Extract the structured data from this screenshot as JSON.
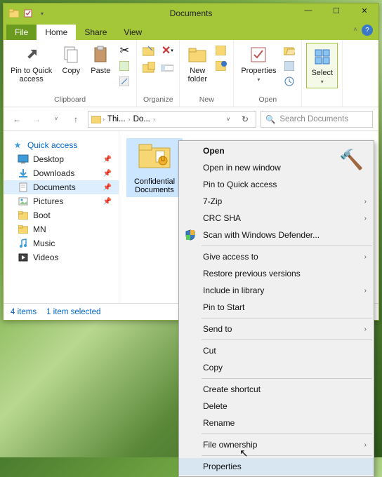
{
  "window": {
    "title": "Documents",
    "buttons": {
      "min": "—",
      "max": "☐",
      "close": "✕"
    }
  },
  "tabs": {
    "file": "File",
    "home": "Home",
    "share": "Share",
    "view": "View"
  },
  "ribbon": {
    "clipboard": {
      "label": "Clipboard",
      "pin": "Pin to Quick\naccess",
      "copy": "Copy",
      "paste": "Paste"
    },
    "organize": {
      "label": "Organize"
    },
    "new": {
      "label": "New",
      "newfolder": "New\nfolder"
    },
    "open": {
      "label": "Open",
      "properties": "Properties"
    },
    "select": {
      "label": "Select",
      "select": "Select"
    }
  },
  "address": {
    "crumb1": "Thi...",
    "crumb2": "Do..."
  },
  "search": {
    "placeholder": "Search Documents"
  },
  "sidebar": {
    "quick": "Quick access",
    "items": [
      {
        "icon": "desktop",
        "label": "Desktop",
        "pin": true
      },
      {
        "icon": "downloads",
        "label": "Downloads",
        "pin": true
      },
      {
        "icon": "documents",
        "label": "Documents",
        "pin": true,
        "selected": true
      },
      {
        "icon": "pictures",
        "label": "Pictures",
        "pin": true
      },
      {
        "icon": "folder",
        "label": "Boot",
        "pin": false
      },
      {
        "icon": "folder",
        "label": "MN",
        "pin": false
      },
      {
        "icon": "music",
        "label": "Music",
        "pin": false
      },
      {
        "icon": "videos",
        "label": "Videos",
        "pin": false
      }
    ]
  },
  "content": {
    "folder_name": "Confidential Documents"
  },
  "status": {
    "items": "4 items",
    "selected": "1 item selected"
  },
  "context_menu": {
    "items": [
      {
        "label": "Open",
        "bold": true
      },
      {
        "label": "Open in new window"
      },
      {
        "label": "Pin to Quick access"
      },
      {
        "label": "7-Zip",
        "submenu": true
      },
      {
        "label": "CRC SHA",
        "submenu": true
      },
      {
        "label": "Scan with Windows Defender...",
        "icon": "shield"
      },
      {
        "sep": true
      },
      {
        "label": "Give access to",
        "submenu": true
      },
      {
        "label": "Restore previous versions"
      },
      {
        "label": "Include in library",
        "submenu": true
      },
      {
        "label": "Pin to Start"
      },
      {
        "sep": true
      },
      {
        "label": "Send to",
        "submenu": true
      },
      {
        "sep": true
      },
      {
        "label": "Cut"
      },
      {
        "label": "Copy"
      },
      {
        "sep": true
      },
      {
        "label": "Create shortcut"
      },
      {
        "label": "Delete"
      },
      {
        "label": "Rename"
      },
      {
        "sep": true
      },
      {
        "label": "File ownership",
        "submenu": true
      },
      {
        "sep": true
      },
      {
        "label": "Properties",
        "hover": true
      }
    ]
  }
}
